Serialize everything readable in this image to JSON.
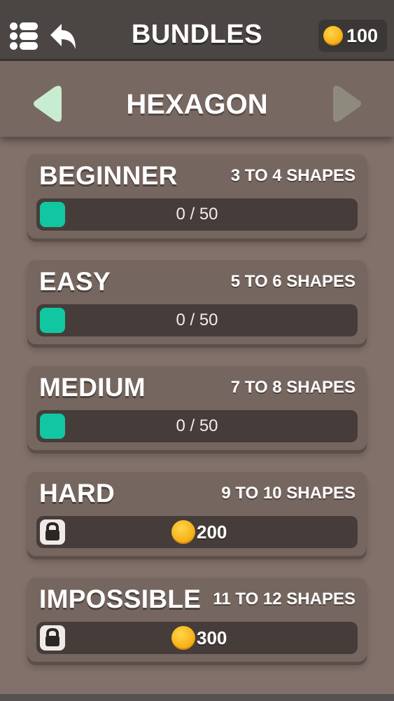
{
  "header": {
    "title": "BUNDLES",
    "coins": "100",
    "menu_icon": "menu-list-icon",
    "back_icon": "back-arrow-icon"
  },
  "category": {
    "title": "HEXAGON",
    "prev_icon": "triangle-left-icon",
    "next_icon": "triangle-right-icon"
  },
  "levels": [
    {
      "name": "BEGINNER",
      "shapes": "3 TO 4 SHAPES",
      "progress": "0 / 50",
      "locked": false
    },
    {
      "name": "EASY",
      "shapes": "5 TO 6 SHAPES",
      "progress": "0 / 50",
      "locked": false
    },
    {
      "name": "MEDIUM",
      "shapes": "7 TO 8 SHAPES",
      "progress": "0 / 50",
      "locked": false
    },
    {
      "name": "HARD",
      "shapes": "9 TO 10 SHAPES",
      "price": "200",
      "locked": true
    },
    {
      "name": "IMPOSSIBLE",
      "shapes": "11 TO 12 SHAPES",
      "price": "300",
      "locked": true
    }
  ],
  "colors": {
    "accent_teal": "#11c7a1",
    "coin_gold": "#f6b21a",
    "prev_arrow": "#c8ecd0",
    "next_arrow": "#8f8a7e"
  }
}
